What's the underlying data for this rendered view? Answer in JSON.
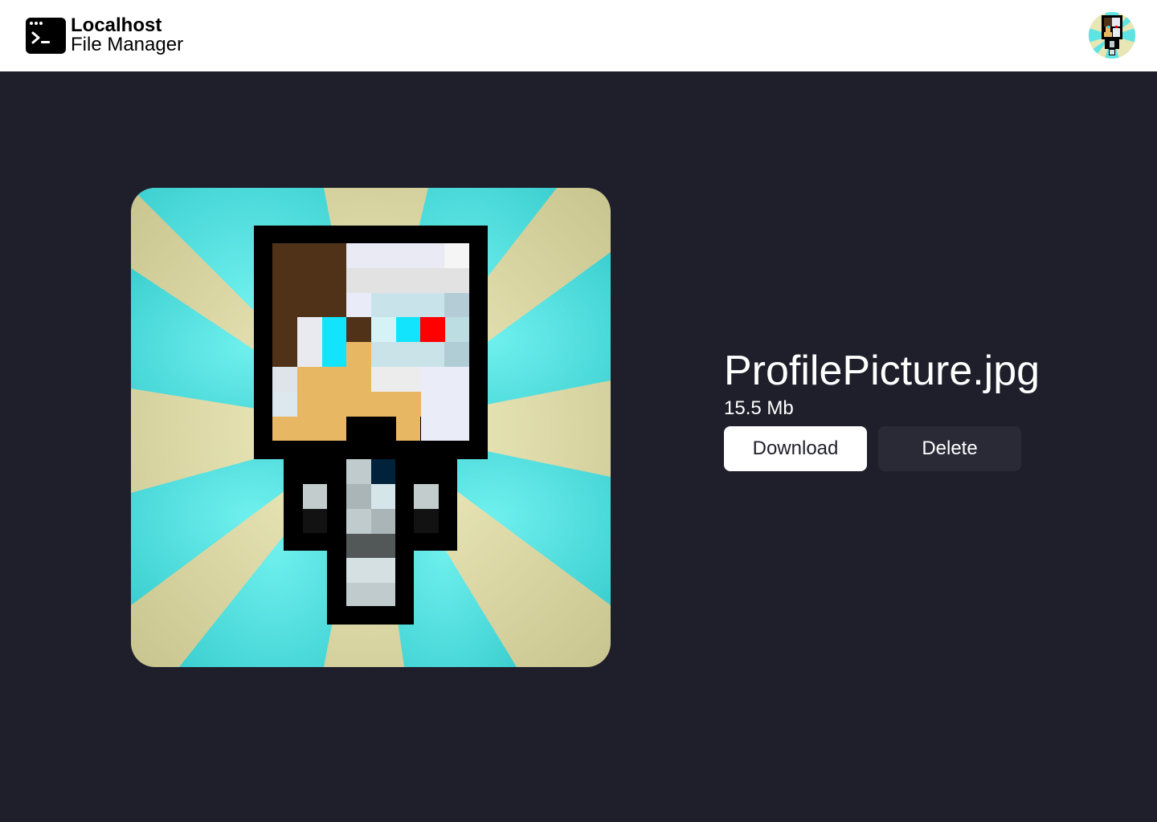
{
  "app": {
    "title": "Localhost",
    "subtitle": "File Manager"
  },
  "header": {
    "avatar_icon": "user-avatar-icon"
  },
  "file": {
    "name": "ProfilePicture.jpg",
    "size": "15.5 Mb"
  },
  "actions": {
    "download_label": "Download",
    "delete_label": "Delete"
  },
  "colors": {
    "background": "#1f1f2b",
    "header": "#ffffff",
    "download_bg": "#ffffff",
    "delete_bg": "#2a2a36"
  }
}
